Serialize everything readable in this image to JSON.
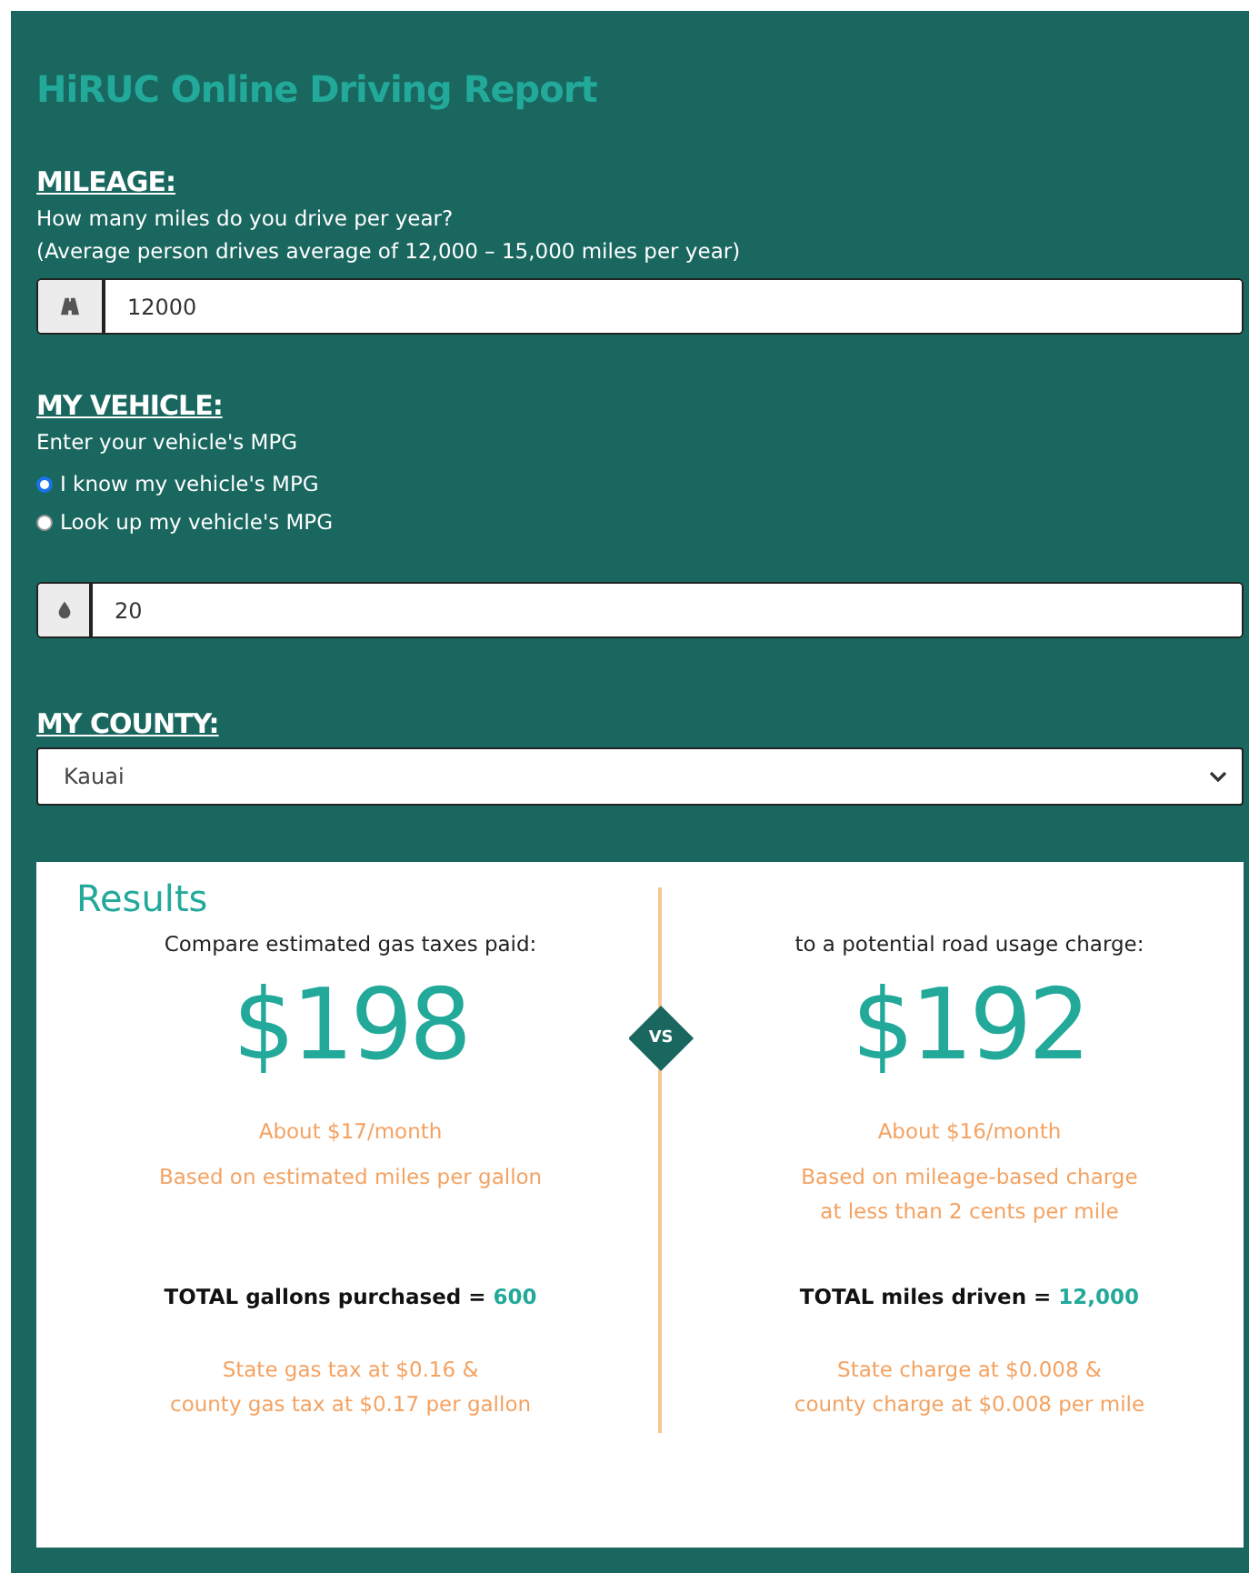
{
  "title": "HiRUC Online Driving Report",
  "mileage": {
    "heading": "MILEAGE:",
    "lines": [
      "How many miles do you drive per year?",
      "(Average person drives average of 12,000 – 15,000 miles per year)"
    ],
    "input": {
      "value": "12000"
    }
  },
  "vehicle": {
    "heading": "MY VEHICLE:",
    "prompt": "Enter your vehicle's MPG",
    "options": [
      {
        "label": "I know my vehicle's MPG",
        "selected": true
      },
      {
        "label": "Look up my vehicle's MPG",
        "selected": false
      }
    ],
    "input": {
      "value": "20"
    }
  },
  "county": {
    "heading": "MY COUNTY:",
    "select": {
      "value": "Kauai"
    }
  },
  "results": {
    "title": "Results",
    "vs": "VS",
    "columns": [
      {
        "intro": "Compare estimated gas taxes paid:",
        "amount": "$198",
        "monthly": "About $17/month",
        "basis": [
          "Based on estimated miles per gallon"
        ],
        "total_label": "TOTAL gallons purchased =",
        "total_value": "600",
        "rate": [
          "State gas tax at $0.16 &",
          "county gas tax at $0.17 per gallon"
        ]
      },
      {
        "intro": "to a potential road usage charge:",
        "amount": "$192",
        "monthly": "About $16/month",
        "basis": [
          "Based on mileage-based charge",
          "at less than 2 cents per mile"
        ],
        "total_label": "TOTAL miles driven =",
        "total_value": "12,000",
        "rate": [
          "State charge at $0.008 &",
          "county charge at $0.008 per mile"
        ]
      }
    ]
  }
}
